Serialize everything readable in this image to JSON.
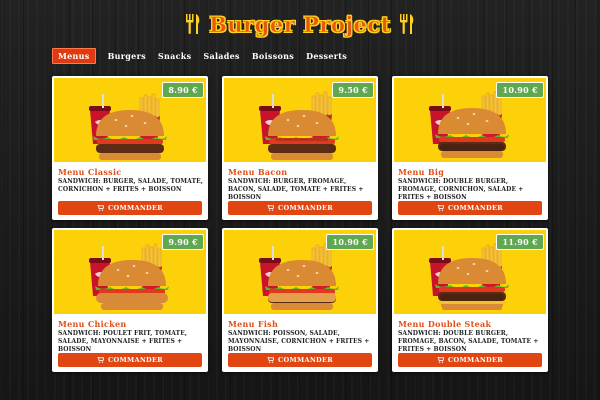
{
  "header": {
    "title": "Burger Project"
  },
  "nav": {
    "items": [
      {
        "label": "Menus",
        "active": true
      },
      {
        "label": "Burgers",
        "active": false
      },
      {
        "label": "Snacks",
        "active": false
      },
      {
        "label": "Salades",
        "active": false
      },
      {
        "label": "Boissons",
        "active": false
      },
      {
        "label": "Desserts",
        "active": false
      }
    ]
  },
  "menus": [
    {
      "title": "Menu Classic",
      "price": "8.90 €",
      "description": "Sandwich: Burger, Salade, Tomate, Cornichon + Frites + Boisson",
      "button": "Commander",
      "image": "burger-classic"
    },
    {
      "title": "Menu Bacon",
      "price": "9.50 €",
      "description": "Sandwich: Burger, Fromage, Bacon, Salade, Tomate + Frites + Boisson",
      "button": "Commander",
      "image": "burger-bacon"
    },
    {
      "title": "Menu Big",
      "price": "10.90 €",
      "description": "Sandwich: Double Burger, Fromage, Cornichon, Salade + Frites + Boisson",
      "button": "Commander",
      "image": "burger-big"
    },
    {
      "title": "Menu Chicken",
      "price": "9.90 €",
      "description": "Sandwich: Poulet Frit, Tomate, Salade, Mayonnaise + Frites + Boisson",
      "button": "Commander",
      "image": "burger-chicken"
    },
    {
      "title": "Menu Fish",
      "price": "10.90 €",
      "description": "Sandwich: Poisson, Salade, Mayonnaise, Cornichon + Frites + Boisson",
      "button": "Commander",
      "image": "burger-fish"
    },
    {
      "title": "Menu Double Steak",
      "price": "11.90 €",
      "description": "Sandwich: Double Burger, Fromage, Bacon, Salade, Tomate + Frites + Boisson",
      "button": "Commander",
      "image": "burger-double-steak"
    }
  ],
  "colors": {
    "accent": "#e14612",
    "price_badge": "#5fa84f",
    "image_bg": "#fdd10a",
    "title_text": "#e05018"
  }
}
